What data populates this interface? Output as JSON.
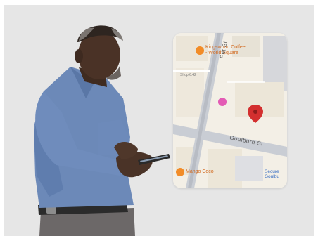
{
  "map": {
    "poi_1": {
      "name_line1": "Kingswood Coffee",
      "name_line2": "- World Square"
    },
    "poi_2": {
      "name": "Mango Coco"
    },
    "streets": {
      "main": "Goulburn St",
      "vertical": "Pitt St",
      "lane": "Shop 6.42"
    },
    "business": {
      "name_line1": "Secure",
      "name_line2": "Goulbu"
    },
    "pin_color": "#d32f2f",
    "poi_icon_color": "#f28c28",
    "shop_icon_color": "#e35bb5"
  },
  "icons": [
    "coffee-cup-icon",
    "shopping-bag-icon",
    "location-pin-icon",
    "food-icon"
  ]
}
